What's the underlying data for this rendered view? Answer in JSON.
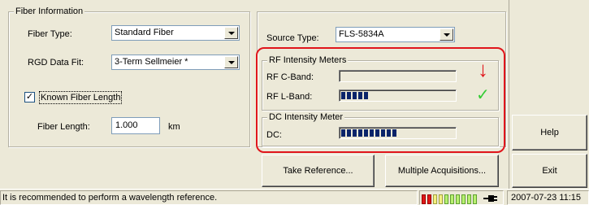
{
  "fiber_info": {
    "title": "Fiber Information",
    "fiber_type_label": "Fiber Type:",
    "fiber_type_value": "Standard Fiber",
    "rgd_label": "RGD Data Fit:",
    "rgd_value": "3-Term Sellmeier *",
    "known_length_label": "Known Fiber Length",
    "known_length_checked": "✓",
    "fiber_length_label": "Fiber Length:",
    "fiber_length_value": "1.000",
    "fiber_length_unit": "km"
  },
  "source": {
    "label": "Source Type:",
    "value": "FLS-5834A"
  },
  "rf_meters": {
    "title": "RF Intensity Meters",
    "c_band_label": "RF C-Band:",
    "c_band_level": 0,
    "l_band_label": "RF L-Band:",
    "l_band_level": 5,
    "c_band_indicator": "↓",
    "l_band_indicator": "✓"
  },
  "dc_meter": {
    "title": "DC Intensity Meter",
    "dc_label": "DC:",
    "dc_level": 10
  },
  "buttons": {
    "take_reference": "Take Reference...",
    "multiple_acquisitions": "Multiple Acquisitions...",
    "help": "Help",
    "exit": "Exit"
  },
  "status": {
    "message": "It is recommended to perform a wavelength reference.",
    "datetime": "2007-07-23 11:15"
  },
  "colors": {
    "highlight": "#e0151b",
    "meter_fill": "#0a246a",
    "arrow_red": "#e0151b",
    "check_green": "#33cc33"
  }
}
